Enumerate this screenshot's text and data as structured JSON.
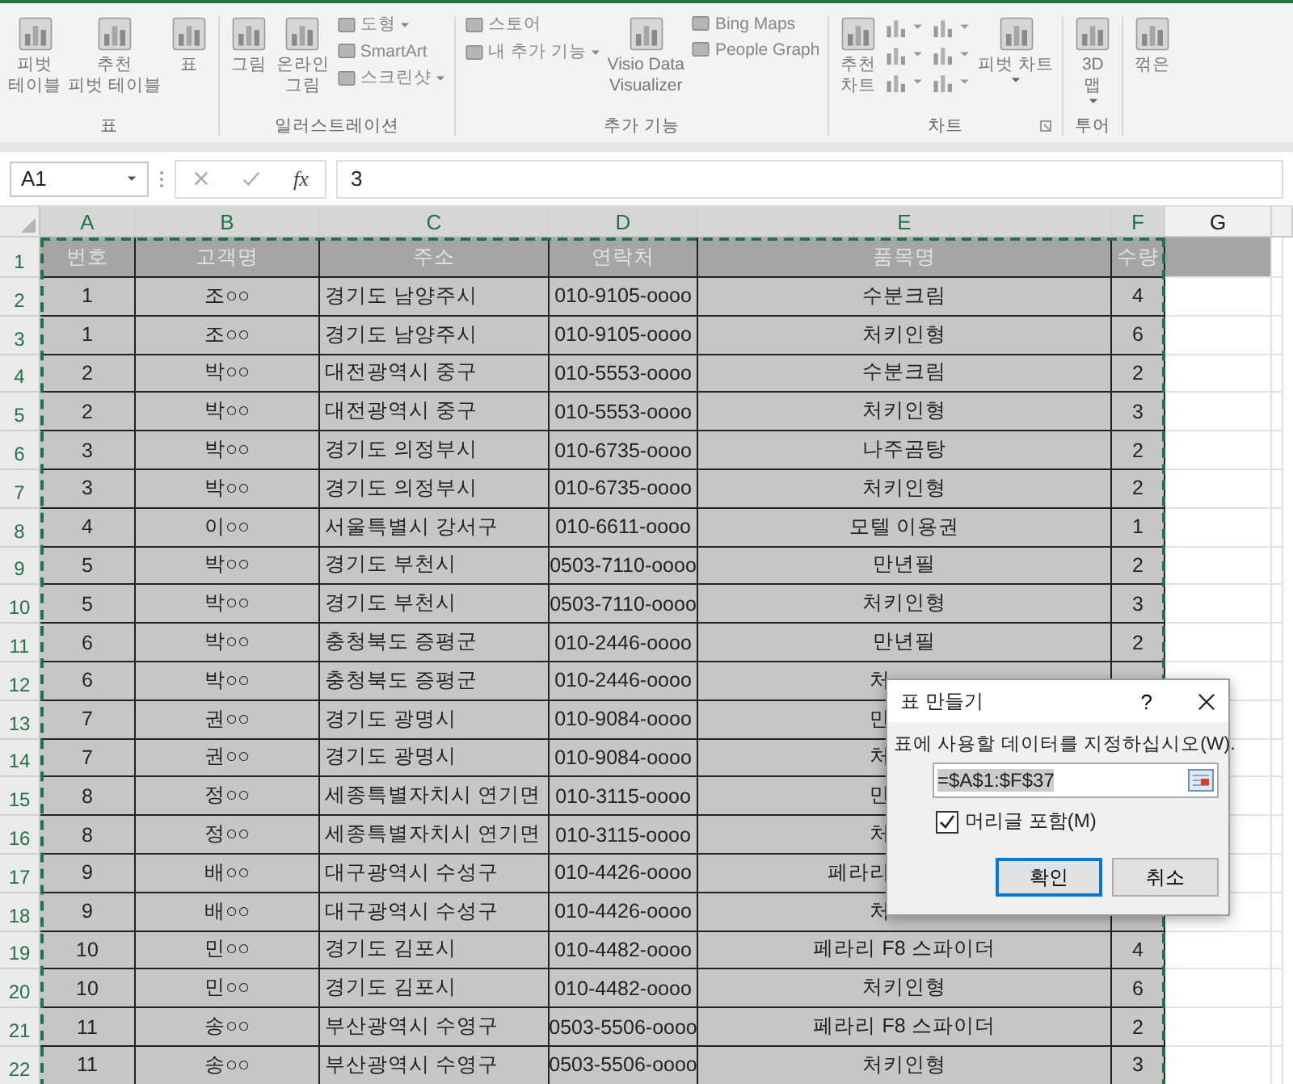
{
  "ribbon": {
    "groups": [
      {
        "label": "표",
        "items": [
          {
            "kind": "large",
            "label": "피벗\n테이블",
            "dropdown": false
          },
          {
            "kind": "large",
            "label": "추천\n피벗 테이블",
            "dropdown": false
          },
          {
            "kind": "large",
            "label": "표",
            "dropdown": false
          }
        ]
      },
      {
        "label": "일러스트레이션",
        "items": [
          {
            "kind": "large",
            "label": "그림",
            "dropdown": false
          },
          {
            "kind": "large",
            "label": "온라인\n그림",
            "dropdown": false
          },
          {
            "kind": "stack",
            "items": [
              {
                "label": "도형",
                "dropdown": true
              },
              {
                "label": "SmartArt",
                "dropdown": false
              },
              {
                "label": "스크린샷",
                "dropdown": true
              }
            ]
          }
        ]
      },
      {
        "label": "추가 기능",
        "items": [
          {
            "kind": "stack",
            "items": [
              {
                "label": "스토어",
                "dropdown": false
              },
              {
                "label": "내 추가 기능",
                "dropdown": true
              }
            ]
          },
          {
            "kind": "large",
            "label": "Visio Data\nVisualizer",
            "dropdown": false
          },
          {
            "kind": "stack",
            "items": [
              {
                "label": "Bing Maps",
                "dropdown": false
              },
              {
                "label": "People Graph",
                "dropdown": false
              }
            ]
          }
        ]
      },
      {
        "label": "차트",
        "launcher": true,
        "items": [
          {
            "kind": "large",
            "label": "추천\n차트",
            "dropdown": false
          },
          {
            "kind": "chart-grid"
          },
          {
            "kind": "large",
            "label": "피벗 차트",
            "dropdown": true
          }
        ]
      },
      {
        "label": "투어",
        "items": [
          {
            "kind": "large",
            "label": "3D\n맵",
            "dropdown": true
          }
        ]
      },
      {
        "items": [
          {
            "kind": "large",
            "label": "꺾은",
            "dropdown": false
          }
        ]
      }
    ]
  },
  "formula_bar": {
    "name_box": "A1",
    "fx": "fx",
    "value": "3"
  },
  "columns": [
    {
      "label": "A",
      "selected": true
    },
    {
      "label": "B",
      "selected": true
    },
    {
      "label": "C",
      "selected": true
    },
    {
      "label": "D",
      "selected": true
    },
    {
      "label": "E",
      "selected": true
    },
    {
      "label": "F",
      "selected": true
    },
    {
      "label": "G",
      "selected": false
    }
  ],
  "rows": [
    {
      "number": "1",
      "header": true,
      "covered": false,
      "cells": [
        "번호",
        "고객명",
        "주소",
        "연락처",
        "품목명",
        "수량"
      ]
    },
    {
      "number": "2",
      "header": false,
      "covered": false,
      "cells": [
        "1",
        "조○○",
        "경기도 남양주시",
        "010-9105-oooo",
        "수분크림",
        "4"
      ]
    },
    {
      "number": "3",
      "header": false,
      "covered": false,
      "cells": [
        "1",
        "조○○",
        "경기도 남양주시",
        "010-9105-oooo",
        "처키인형",
        "6"
      ]
    },
    {
      "number": "4",
      "header": false,
      "covered": false,
      "cells": [
        "2",
        "박○○",
        "대전광역시 중구",
        "010-5553-oooo",
        "수분크림",
        "2"
      ]
    },
    {
      "number": "5",
      "header": false,
      "covered": false,
      "cells": [
        "2",
        "박○○",
        "대전광역시 중구",
        "010-5553-oooo",
        "처키인형",
        "3"
      ]
    },
    {
      "number": "6",
      "header": false,
      "covered": false,
      "cells": [
        "3",
        "박○○",
        "경기도 의정부시",
        "010-6735-oooo",
        "나주곰탕",
        "2"
      ]
    },
    {
      "number": "7",
      "header": false,
      "covered": false,
      "cells": [
        "3",
        "박○○",
        "경기도 의정부시",
        "010-6735-oooo",
        "처키인형",
        "2"
      ]
    },
    {
      "number": "8",
      "header": false,
      "covered": false,
      "cells": [
        "4",
        "이○○",
        "서울특별시 강서구",
        "010-6611-oooo",
        "모텔 이용권",
        "1"
      ]
    },
    {
      "number": "9",
      "header": false,
      "covered": false,
      "cells": [
        "5",
        "박○○",
        "경기도 부천시",
        "0503-7110-oooo",
        "만년필",
        "2"
      ]
    },
    {
      "number": "10",
      "header": false,
      "covered": false,
      "cells": [
        "5",
        "박○○",
        "경기도 부천시",
        "0503-7110-oooo",
        "처키인형",
        "3"
      ]
    },
    {
      "number": "11",
      "header": false,
      "covered": false,
      "cells": [
        "6",
        "박○○",
        "충청북도 증평군",
        "010-2446-oooo",
        "만년필",
        "2"
      ]
    },
    {
      "number": "12",
      "header": false,
      "covered": true,
      "cells": [
        "6",
        "박○○",
        "충청북도 증평군",
        "010-2446-oooo",
        "처"
      ]
    },
    {
      "number": "13",
      "header": false,
      "covered": true,
      "cells": [
        "7",
        "권○○",
        "경기도 광명시",
        "010-9084-oooo",
        "만"
      ]
    },
    {
      "number": "14",
      "header": false,
      "covered": true,
      "cells": [
        "7",
        "권○○",
        "경기도 광명시",
        "010-9084-oooo",
        "처"
      ]
    },
    {
      "number": "15",
      "header": false,
      "covered": true,
      "cells": [
        "8",
        "정○○",
        "세종특별자치시 연기면",
        "010-3115-oooo",
        "만"
      ]
    },
    {
      "number": "16",
      "header": false,
      "covered": true,
      "cells": [
        "8",
        "정○○",
        "세종특별자치시 연기면",
        "010-3115-oooo",
        "처"
      ]
    },
    {
      "number": "17",
      "header": false,
      "covered": true,
      "cells": [
        "9",
        "배○○",
        "대구광역시 수성구",
        "010-4426-oooo",
        "페라리"
      ]
    },
    {
      "number": "18",
      "header": false,
      "covered": true,
      "cells": [
        "9",
        "배○○",
        "대구광역시 수성구",
        "010-4426-oooo",
        "처"
      ]
    },
    {
      "number": "19",
      "header": false,
      "covered": false,
      "cells": [
        "10",
        "민○○",
        "경기도 김포시",
        "010-4482-oooo",
        "페라리 F8 스파이더",
        "4"
      ]
    },
    {
      "number": "20",
      "header": false,
      "covered": false,
      "cells": [
        "10",
        "민○○",
        "경기도 김포시",
        "010-4482-oooo",
        "처키인형",
        "6"
      ]
    },
    {
      "number": "21",
      "header": false,
      "covered": false,
      "cells": [
        "11",
        "송○○",
        "부산광역시 수영구",
        "0503-5506-oooo",
        "페라리 F8 스파이더",
        "2"
      ]
    },
    {
      "number": "22",
      "header": false,
      "covered": false,
      "cells": [
        "11",
        "송○○",
        "부산광역시 수영구",
        "0503-5506-oooo",
        "처키인형",
        "3"
      ]
    }
  ],
  "dialog": {
    "title": "표 만들기",
    "help": "?",
    "prompt": "표에 사용할 데이터를 지정하십시오(W).",
    "range": "=$A$1:$F$37",
    "checkbox": {
      "label": "머리글 포함(M)",
      "checked": true
    },
    "buttons": [
      {
        "label": "확인",
        "default": true
      },
      {
        "label": "취소",
        "default": false
      }
    ]
  }
}
